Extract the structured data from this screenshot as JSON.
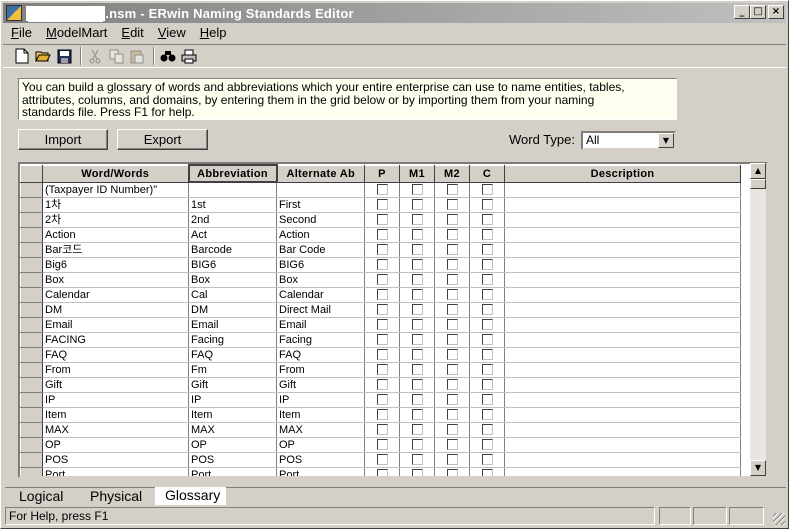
{
  "window": {
    "title_hidden": "████████",
    "title": ".nsm - ERwin Naming Standards Editor",
    "buttons": {
      "minimize": "_",
      "maximize": "□",
      "close": "×"
    }
  },
  "menu": {
    "items": [
      {
        "label": "File",
        "key": "F"
      },
      {
        "label": "ModelMart",
        "key": "M"
      },
      {
        "label": "Edit",
        "key": "E"
      },
      {
        "label": "View",
        "key": "V"
      },
      {
        "label": "Help",
        "key": "H"
      }
    ]
  },
  "toolbar": {
    "icons": [
      "new-file-icon",
      "open-folder-icon",
      "save-icon",
      "cut-icon",
      "copy-icon",
      "paste-icon",
      "find-icon",
      "print-icon"
    ]
  },
  "info_text": "You can build a glossary of words and abbreviations which your entire enterprise can use to name entities, tables,\nattributes, columns, and domains, by entering them in the grid below or by importing them from your naming\nstandards file. Press F1 for help.",
  "buttons": {
    "import": "Import",
    "export": "Export"
  },
  "word_type": {
    "label": "Word Type:",
    "value": "All"
  },
  "grid": {
    "columns": [
      "Word/Words",
      "Abbreviation",
      "Alternate Ab",
      "P",
      "M1",
      "M2",
      "C",
      "Description"
    ],
    "rows": [
      [
        "(Taxpayer ID Number)\"",
        "",
        ""
      ],
      [
        "1차",
        "1st",
        "First"
      ],
      [
        "2차",
        "2nd",
        "Second"
      ],
      [
        "Action",
        "Act",
        "Action"
      ],
      [
        "Bar코드",
        "Barcode",
        "Bar Code"
      ],
      [
        "Big6",
        "BIG6",
        "BIG6"
      ],
      [
        "Box",
        "Box",
        "Box"
      ],
      [
        "Calendar",
        "Cal",
        "Calendar"
      ],
      [
        "DM",
        "DM",
        "Direct Mail"
      ],
      [
        "Email",
        "Email",
        "Email"
      ],
      [
        "FACING",
        "Facing",
        "Facing"
      ],
      [
        "FAQ",
        "FAQ",
        "FAQ"
      ],
      [
        "From",
        "Fm",
        "From"
      ],
      [
        "Gift",
        "Gift",
        "Gift"
      ],
      [
        "IP",
        "IP",
        "IP"
      ],
      [
        "Item",
        "Item",
        "Item"
      ],
      [
        "MAX",
        "MAX",
        "MAX"
      ],
      [
        "OP",
        "OP",
        "OP"
      ],
      [
        "POS",
        "POS",
        "POS"
      ],
      [
        "Port",
        "Port",
        "Port"
      ]
    ]
  },
  "tabs": [
    {
      "label": "Logical",
      "active": false
    },
    {
      "label": "Physical",
      "active": false
    },
    {
      "label": "Glossary",
      "active": true
    }
  ],
  "status": {
    "text": "For Help, press F1"
  }
}
